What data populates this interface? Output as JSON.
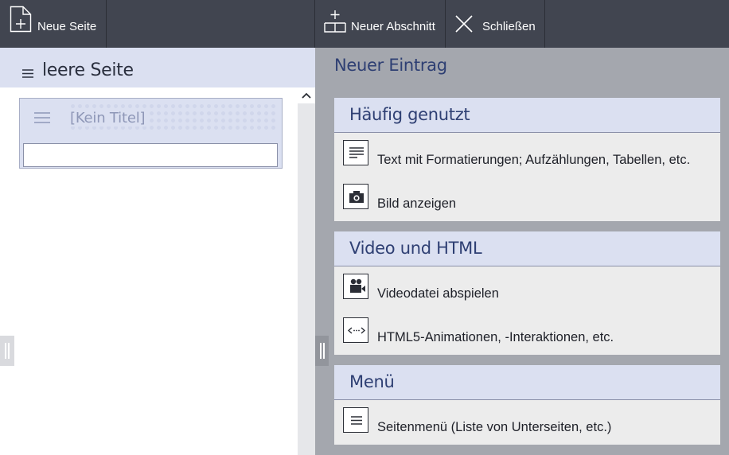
{
  "toolbar": {
    "new_page_label": "Neue Seite",
    "new_section_label": "Neuer Abschnitt",
    "close_label": "Schließen"
  },
  "left": {
    "page_heading": "leere Seite",
    "card_title": "[Kein Titel]",
    "title_input_value": ""
  },
  "right": {
    "heading": "Neuer Eintrag",
    "sections": [
      {
        "title": "Häufig genutzt",
        "entries": [
          {
            "label": "Text mit Formatierungen; Aufzählungen, Tabellen, etc.",
            "icon": "text-lines-icon"
          },
          {
            "label": "Bild anzeigen",
            "icon": "camera-icon"
          }
        ]
      },
      {
        "title": "Video und HTML",
        "entries": [
          {
            "label": "Videodatei abspielen",
            "icon": "video-camera-icon"
          },
          {
            "label": "HTML5-Animationen, -Interaktionen, etc.",
            "icon": "code-icon"
          }
        ]
      },
      {
        "title": "Menü",
        "entries": [
          {
            "label": "Seitenmenü (Liste von Unterseiten, etc.)",
            "icon": "list-icon"
          }
        ]
      }
    ]
  },
  "colors": {
    "toolbar_bg": "#414550",
    "accent_light": "#dbe0f1",
    "heading_blue": "#2e3f73",
    "right_pane_bg": "#a4a7ae"
  }
}
